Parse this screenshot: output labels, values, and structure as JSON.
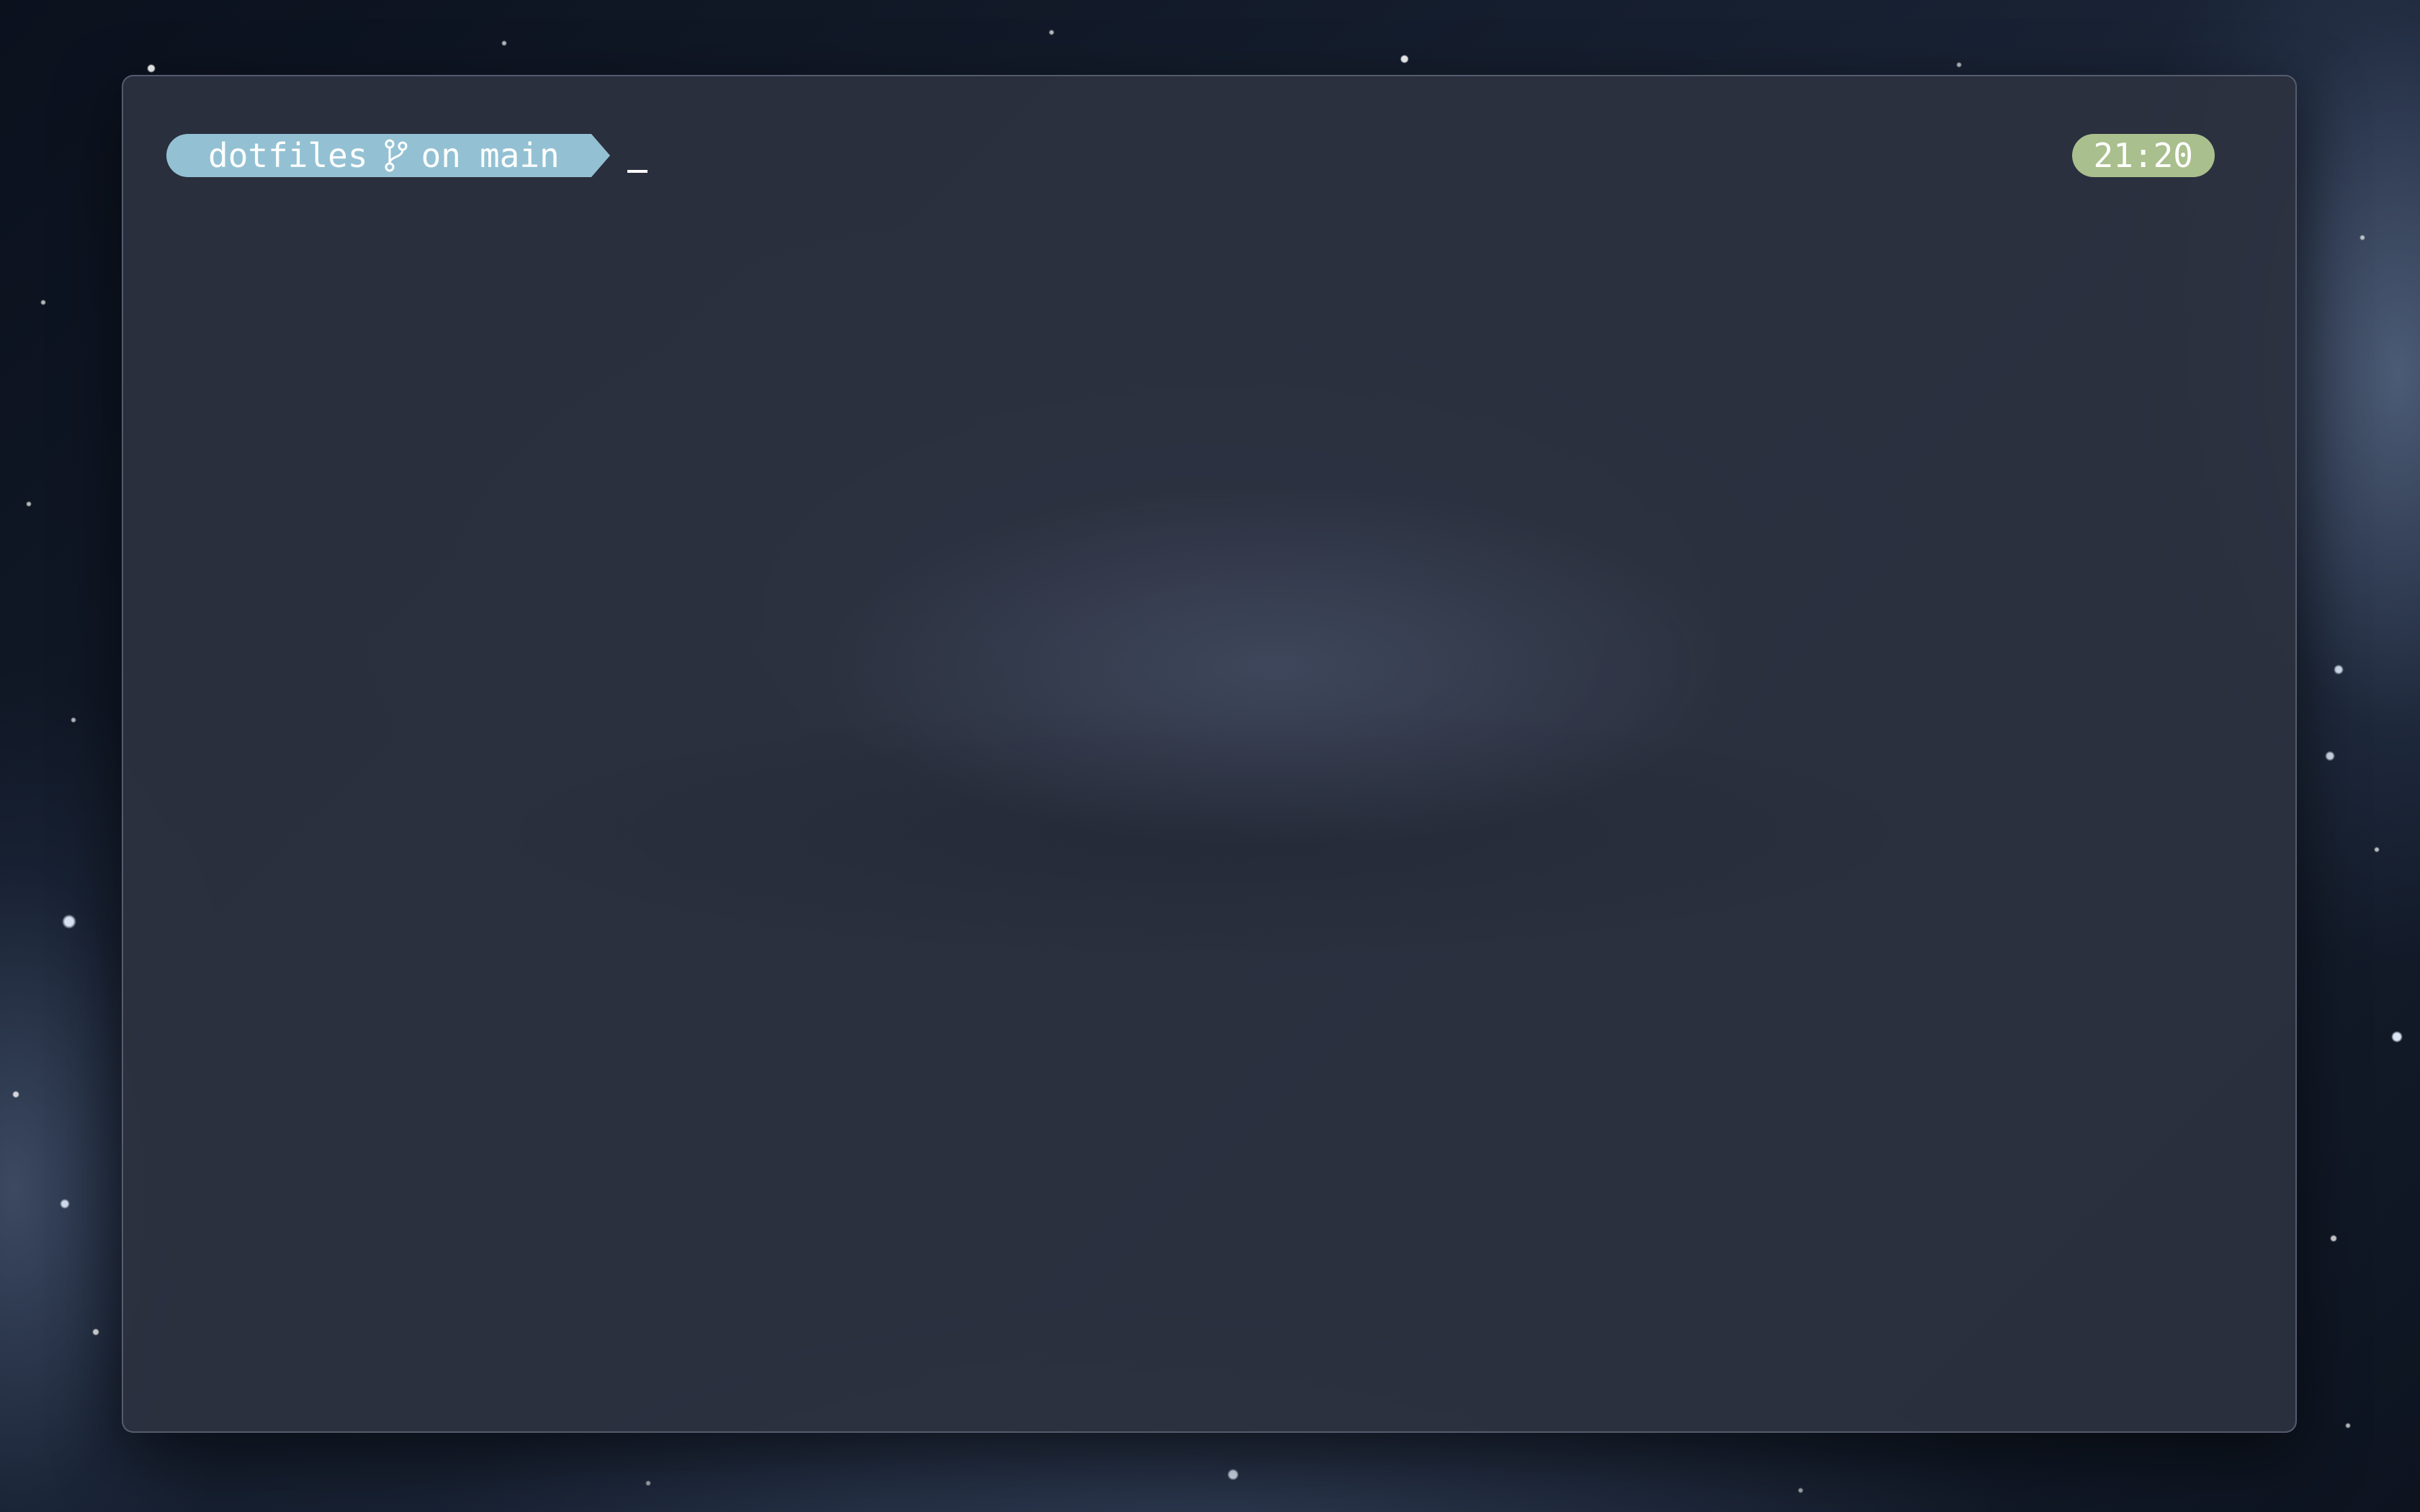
{
  "prompt": {
    "directory": "dotfiles",
    "git_icon": "git-branch-icon",
    "branch_prefix": "on",
    "branch": "main",
    "cursor": "_"
  },
  "clock": {
    "time": "21:20"
  },
  "colors": {
    "prompt_segment": "#93c1d3",
    "time_pill": "#a9bf8d",
    "terminal_background": "#2c3240"
  }
}
